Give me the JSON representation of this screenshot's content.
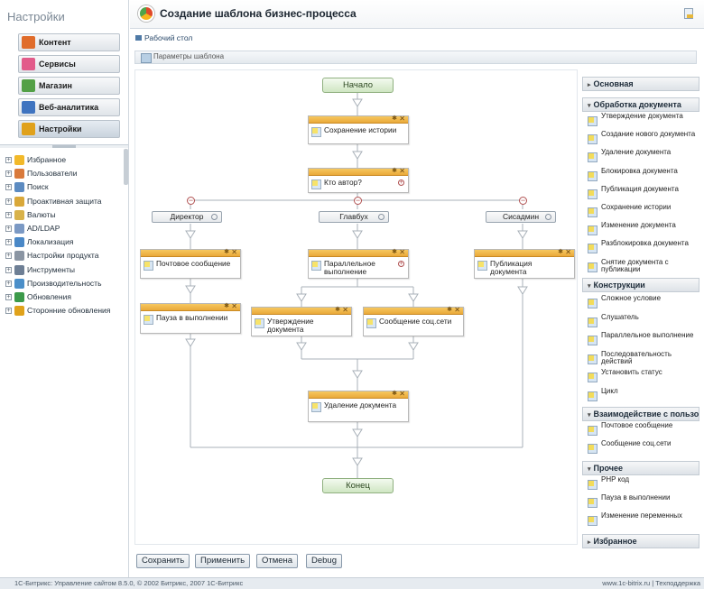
{
  "left_panel": {
    "title": "Настройки",
    "sections": [
      {
        "label": "Контент",
        "color": "#e06c2b"
      },
      {
        "label": "Сервисы",
        "color": "#e25b8a"
      },
      {
        "label": "Магазин",
        "color": "#53a046"
      },
      {
        "label": "Веб-аналитика",
        "color": "#3f74c0"
      },
      {
        "label": "Настройки",
        "color": "#e0a11b"
      }
    ],
    "tree": [
      {
        "label": "Избранное",
        "icon": "star-icon",
        "color": "#f2b92a"
      },
      {
        "label": "Пользователи",
        "icon": "users-icon",
        "color": "#d97a3c"
      },
      {
        "label": "Поиск",
        "icon": "search-icon",
        "color": "#5c8bc1"
      },
      {
        "label": "Проактивная защита",
        "icon": "shield-icon",
        "color": "#d9a83a"
      },
      {
        "label": "Валюты",
        "icon": "currency-icon",
        "color": "#d8b24a"
      },
      {
        "label": "AD/LDAP",
        "icon": "ldap-icon",
        "color": "#7b99c4"
      },
      {
        "label": "Локализация",
        "icon": "globe-icon",
        "color": "#4a88c7"
      },
      {
        "label": "Настройки продукта",
        "icon": "settings-icon",
        "color": "#8a95a3"
      },
      {
        "label": "Инструменты",
        "icon": "tools-icon",
        "color": "#6e7f95"
      },
      {
        "label": "Производительность",
        "icon": "performance-icon",
        "color": "#4b8fc9"
      },
      {
        "label": "Обновления",
        "icon": "update-icon",
        "color": "#3c9a4a"
      },
      {
        "label": "Сторонние обновления",
        "icon": "thirdparty-update-icon",
        "color": "#e0a21b"
      }
    ]
  },
  "header": {
    "title": "Создание шаблона бизнес-процесса"
  },
  "breadcrumb": {
    "label": "Рабочий стол"
  },
  "toolbar": {
    "params_label": "Параметры шаблона"
  },
  "workflow": {
    "start": "Начало",
    "end": "Конец",
    "save_history": "Сохранение истории",
    "who_author": "Кто автор?",
    "branches": [
      "Директор",
      "Главбух",
      "Сисадмин"
    ],
    "mail_message": "Почтовое сообщение",
    "pause": "Пауза в выполнении",
    "parallel": "Параллельное выполнение",
    "approve_doc": "Утверждение документа",
    "social_message": "Сообщение соц.сети",
    "publish_doc": "Публикация документа",
    "delete_doc": "Удаление документа"
  },
  "buttons": {
    "save": "Сохранить",
    "apply": "Применить",
    "cancel": "Отмена",
    "debug": "Debug"
  },
  "palette": {
    "main": "Основная",
    "doc_processing": "Обработка документа",
    "doc_items": [
      "Утверждение документа",
      "Создание нового документа",
      "Удаление документа",
      "Блокировка документа",
      "Публикация документа",
      "Сохранение истории",
      "Изменение документа",
      "Разблокировка документа",
      "Снятие документа с публикации"
    ],
    "constructs": "Конструкции",
    "construct_items": [
      "Сложное условие",
      "Слушатель",
      "Параллельное выполнение",
      "Последовательность действий",
      "Установить статус",
      "Цикл"
    ],
    "interaction": "Взаимодействие с пользователем",
    "interaction_items": [
      "Почтовое сообщение",
      "Сообщение соц.сети"
    ],
    "other": "Прочее",
    "other_items": [
      "PHP код",
      "Пауза в выполнении",
      "Изменение переменных"
    ],
    "favorites": "Избранное"
  },
  "footer": {
    "left": "1С-Битрикс: Управление сайтом 8.5.0, © 2002 Битрикс, 2007 1С-Битрикс",
    "right": "www.1c-bitrix.ru  |  Техподдержка"
  }
}
